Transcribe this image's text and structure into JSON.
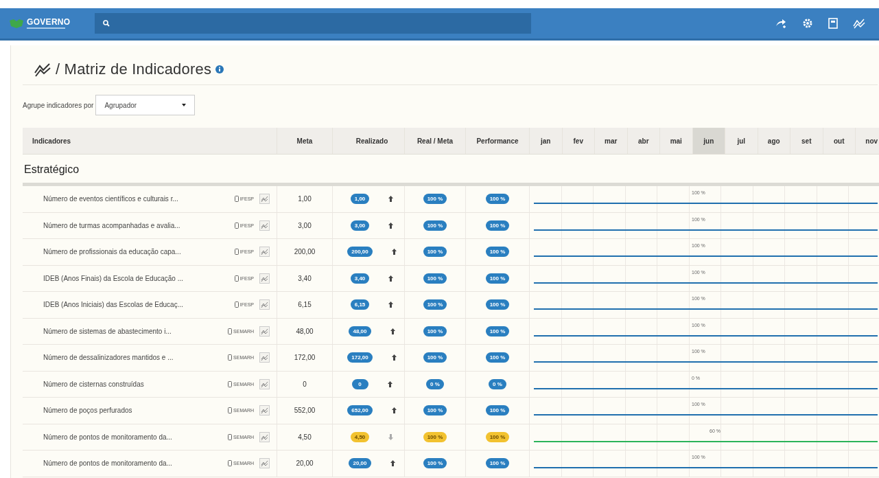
{
  "topbar": {
    "logo": "GOVERNO"
  },
  "page": {
    "title": "/ Matriz de Indicadores"
  },
  "group_by": {
    "label": "Agrupe indicadores por",
    "value": "Agrupador"
  },
  "table": {
    "columns": [
      "Indicadores",
      "Meta",
      "Realizado",
      "Real / Meta",
      "Performance"
    ],
    "months": [
      {
        "label": "jan",
        "selected": false
      },
      {
        "label": "fev",
        "selected": false
      },
      {
        "label": "mar",
        "selected": false
      },
      {
        "label": "abr",
        "selected": false
      },
      {
        "label": "mai",
        "selected": false
      },
      {
        "label": "jun",
        "selected": true
      },
      {
        "label": "jul",
        "selected": false
      },
      {
        "label": "ago",
        "selected": false
      },
      {
        "label": "set",
        "selected": false
      },
      {
        "label": "out",
        "selected": false
      },
      {
        "label": "nov",
        "selected": false
      }
    ],
    "group": "Estratégico",
    "rows": [
      {
        "name": "Número de eventos científicos e culturais r...",
        "org": "IFESP",
        "meta": "1,00",
        "realizado": "1,00",
        "real_meta": "100 %",
        "performance": "100 %",
        "month_value": "100 %",
        "kind": "up"
      },
      {
        "name": "Número de turmas acompanhadas e avalia...",
        "org": "IFESP",
        "meta": "3,00",
        "realizado": "3,00",
        "real_meta": "100 %",
        "performance": "100 %",
        "month_value": "100 %",
        "kind": "up"
      },
      {
        "name": "Número de profissionais da educação capa...",
        "org": "IFESP",
        "meta": "200,00",
        "realizado": "200,00",
        "real_meta": "100 %",
        "performance": "100 %",
        "month_value": "100 %",
        "kind": "up"
      },
      {
        "name": "IDEB (Anos Finais) da Escola de Educação ...",
        "org": "IFESP",
        "meta": "3,40",
        "realizado": "3,40",
        "real_meta": "100 %",
        "performance": "100 %",
        "month_value": "100 %",
        "kind": "up"
      },
      {
        "name": "IDEB (Anos Iniciais) das Escolas de Educaç...",
        "org": "IFESP",
        "meta": "6,15",
        "realizado": "6,15",
        "real_meta": "100 %",
        "performance": "100 %",
        "month_value": "100 %",
        "kind": "up"
      },
      {
        "name": "Número de sistemas de abastecimento i...",
        "org": "SEMARH",
        "meta": "48,00",
        "realizado": "48,00",
        "real_meta": "100 %",
        "performance": "100 %",
        "month_value": "100 %",
        "kind": "up"
      },
      {
        "name": "Número de dessalinizadores mantidos e ...",
        "org": "SEMARH",
        "meta": "172,00",
        "realizado": "172,00",
        "real_meta": "100 %",
        "performance": "100 %",
        "month_value": "100 %",
        "kind": "up"
      },
      {
        "name": "Número de cisternas construídas",
        "org": "SEMARH",
        "meta": "0",
        "realizado": "0",
        "real_meta": "0 %",
        "performance": "0 %",
        "month_value": "0 %",
        "kind": "up"
      },
      {
        "name": "Número de poços perfurados",
        "org": "SEMARH",
        "meta": "552,00",
        "realizado": "652,00",
        "real_meta": "100 %",
        "performance": "100 %",
        "month_value": "100 %",
        "kind": "up"
      },
      {
        "name": "Número de pontos de monitoramento da...",
        "org": "SEMARH",
        "meta": "4,50",
        "realizado": "4,50",
        "real_meta": "100 %",
        "performance": "100 %",
        "month_value": "60 %",
        "kind": "down"
      },
      {
        "name": "Número de pontos de monitoramento da...",
        "org": "SEMARH",
        "meta": "20,00",
        "realizado": "20,00",
        "real_meta": "100 %",
        "performance": "100 %",
        "month_value": "100 %",
        "kind": "up"
      }
    ]
  }
}
